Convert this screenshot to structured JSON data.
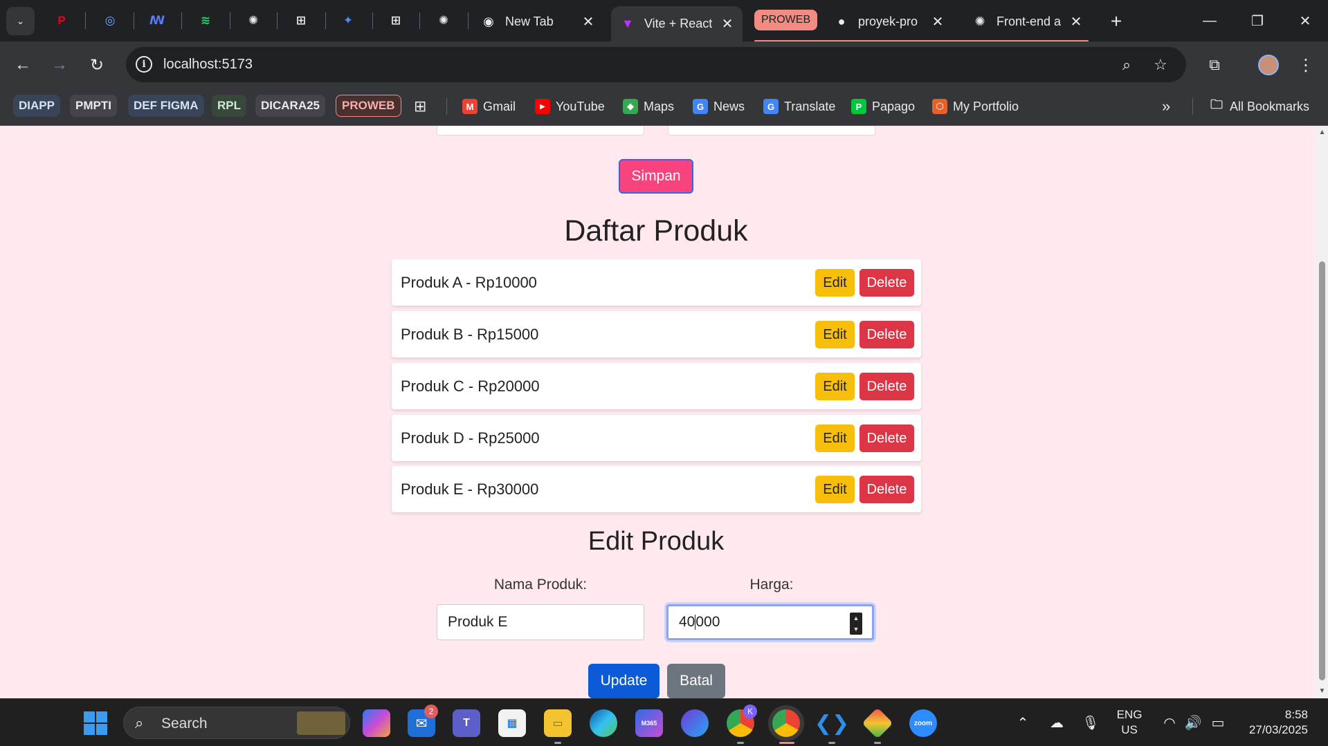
{
  "browser": {
    "tabs": [
      {
        "title": "New Tab",
        "icon": "chrome-icon"
      },
      {
        "title": "Vite + React",
        "icon": "vite-icon",
        "active": true
      },
      {
        "title": "proyek-pro",
        "icon": "github-icon"
      },
      {
        "title": "Front-end a",
        "icon": "openai-icon"
      }
    ],
    "group_label": "PROWEB",
    "address": "localhost:5173",
    "bookmark_chips": [
      {
        "label": "DIAPP",
        "bg": "#394457",
        "fg": "#d2e3fc"
      },
      {
        "label": "PMPTI",
        "bg": "#44444a",
        "fg": "#e8eaed"
      },
      {
        "label": "DEF FIGMA",
        "bg": "#394457",
        "fg": "#d2e3fc"
      },
      {
        "label": "RPL",
        "bg": "#37483b",
        "fg": "#ceead6"
      },
      {
        "label": "DICARA25",
        "bg": "#44444a",
        "fg": "#e8eaed"
      },
      {
        "label": "PROWEB",
        "bg": "#4a2f2f",
        "fg": "#f6aea9"
      }
    ],
    "bookmark_links": [
      {
        "label": "Gmail",
        "icon": "gmail-icon",
        "color": "#ea4335",
        "glyph": "M"
      },
      {
        "label": "YouTube",
        "icon": "youtube-icon",
        "color": "#ff0000",
        "glyph": "▶"
      },
      {
        "label": "Maps",
        "icon": "maps-icon",
        "color": "#34a853",
        "glyph": "◆"
      },
      {
        "label": "News",
        "icon": "news-icon",
        "color": "#4285f4",
        "glyph": "G"
      },
      {
        "label": "Translate",
        "icon": "translate-icon",
        "color": "#4285f4",
        "glyph": "G"
      },
      {
        "label": "Papago",
        "icon": "papago-icon",
        "color": "#00c73c",
        "glyph": "P"
      },
      {
        "label": "My Portfolio",
        "icon": "portfolio-icon",
        "color": "#e6602b",
        "glyph": "⬡"
      }
    ],
    "all_bookmarks": "All Bookmarks"
  },
  "page": {
    "save_button": "Simpan",
    "list_heading": "Daftar Produk",
    "products": [
      {
        "text": "Produk A - Rp10000"
      },
      {
        "text": "Produk B - Rp15000"
      },
      {
        "text": "Produk C - Rp20000"
      },
      {
        "text": "Produk D - Rp25000"
      },
      {
        "text": "Produk E - Rp30000"
      }
    ],
    "edit_label": "Edit",
    "delete_label": "Delete",
    "edit_heading": "Edit Produk",
    "name_label": "Nama Produk:",
    "name_value": "Produk E",
    "price_label": "Harga:",
    "price_value_before_caret": "40",
    "price_value_after_caret": "000",
    "update_button": "Update",
    "cancel_button": "Batal"
  },
  "colors": {
    "page_bg": "#ffe9ee",
    "save_button": "#f8437d",
    "edit_button": "#f7bf0b",
    "delete_button": "#dc3545",
    "update_button": "#0c5bd6",
    "cancel_button": "#6c757d"
  },
  "taskbar": {
    "search_label": "Search",
    "mail_badge": "2",
    "chrome_badge": "K",
    "edge_label": "M365",
    "zoom_label": "zoom",
    "language": [
      "ENG",
      "US"
    ],
    "time": "8:58",
    "date": "27/03/2025"
  }
}
